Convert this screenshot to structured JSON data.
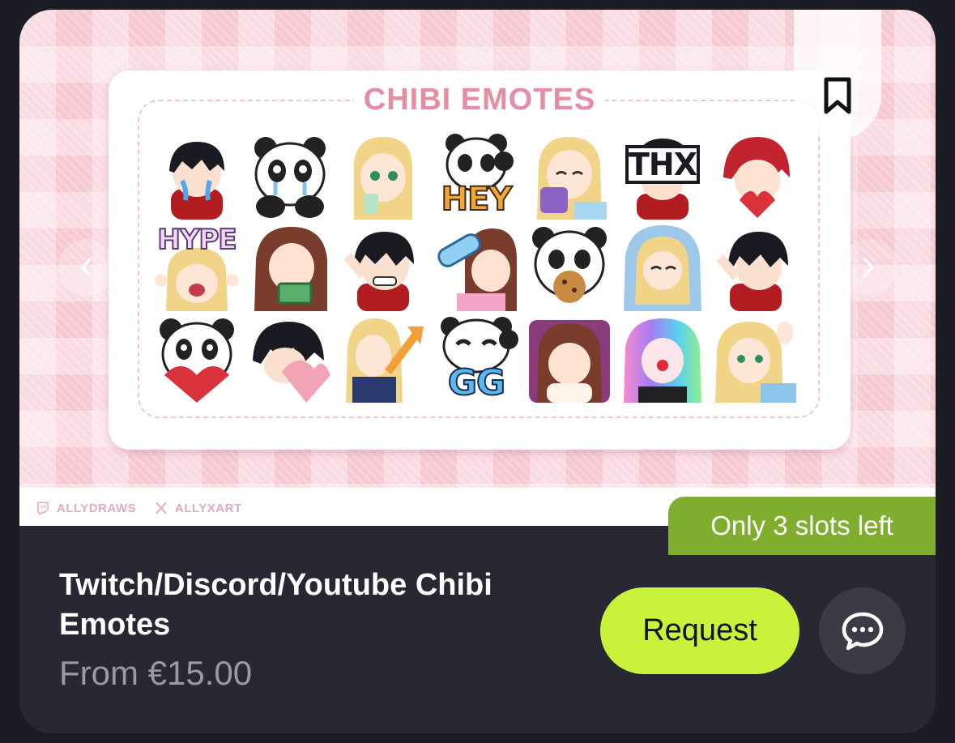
{
  "listing": {
    "title": "Twitch/Discord/Youtube Chibi Emotes",
    "price": "From €15.00",
    "badge": "Only 3 slots left",
    "request_label": "Request"
  },
  "banner": {
    "heading": "CHIBI EMOTES",
    "twitch_handle": "ALLYDRAWS",
    "x_handle": "ALLYXART",
    "emote_texts": {
      "hey": "HEY",
      "thx": "THX",
      "hype": "HYPE",
      "gg": "GG"
    }
  },
  "icons": {
    "bookmark": "bookmark-icon",
    "chat": "chat-bubble-icon",
    "prev": "chevron-left-icon",
    "next": "chevron-right-icon",
    "twitch": "twitch-icon",
    "x": "x-logo-icon"
  },
  "colors": {
    "card_bg": "#272834",
    "page_bg": "#1b1c25",
    "accent_button": "#c9f23b",
    "badge_bg": "#7fae2e",
    "banner_pink": "#f6c9d3",
    "heading_pink": "#e58ea3"
  }
}
